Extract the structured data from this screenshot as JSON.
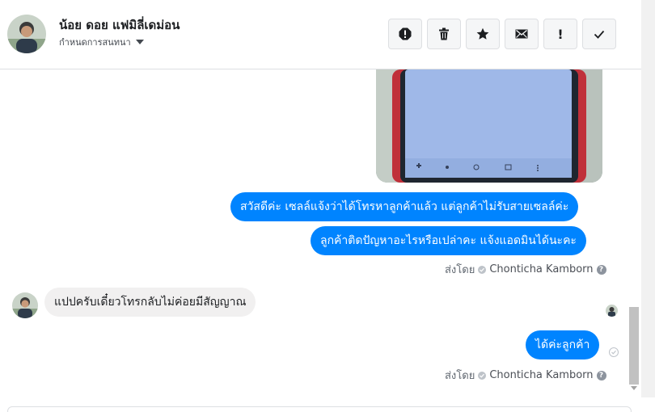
{
  "header": {
    "contact_name": "น้อย ดอย แฟมิลี่เดม่อน",
    "settings_label": "กำหนดการสนทนา"
  },
  "actions": [
    {
      "name": "report-icon",
      "label": ""
    },
    {
      "name": "trash-icon",
      "label": ""
    },
    {
      "name": "star-icon",
      "label": ""
    },
    {
      "name": "mail-icon",
      "label": ""
    },
    {
      "name": "exclamation-icon",
      "label": "!"
    },
    {
      "name": "checkmark-icon",
      "label": ""
    }
  ],
  "messages": {
    "out1": "สวัสดีค่ะ เซลล์แจ้งว่าได้โทรหาลูกค้าแล้ว แต่ลูกค้าไม่รับสายเซลล์ค่ะ",
    "out2": "ลูกค้าติดปัญหาอะไรหรือเปล่าคะ แจ้งแอดมินได้นะคะ",
    "in1": "แปปครับเดี๋ยวโทรกลับไม่ค่อยมีสัญญาณ",
    "out3": "ได้ค่ะลูกค้า"
  },
  "sent_by": {
    "prefix": "ส่งโดย",
    "name": "Chonticha Kamborn",
    "help": "?"
  },
  "colors": {
    "outgoing_bubble": "#0084ff",
    "incoming_bubble": "#f1f0f0"
  }
}
